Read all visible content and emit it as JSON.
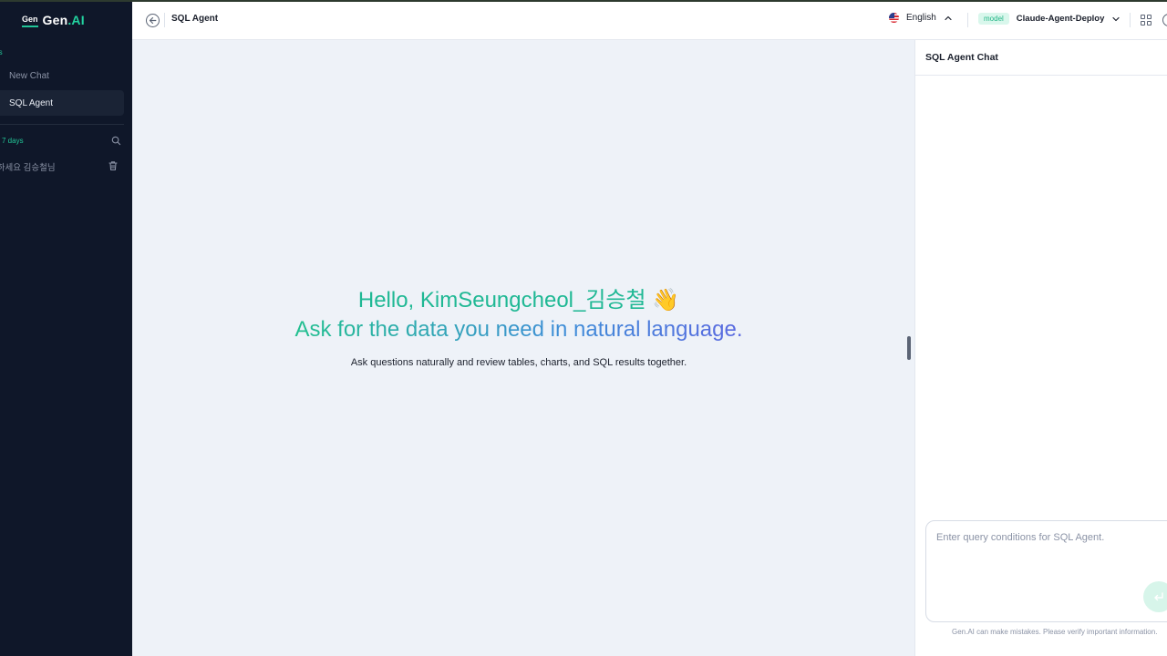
{
  "app": {
    "logo_badge": "Gen",
    "logo_name": "Gen",
    "logo_suffix": ".AI"
  },
  "sidebar": {
    "section_label": "ools",
    "items": [
      {
        "label": "New Chat"
      },
      {
        "label": "SQL Agent"
      }
    ],
    "history_header": "7 days",
    "history_items": [
      {
        "label": "녕하세요 김승철님"
      }
    ]
  },
  "topbar": {
    "title": "SQL Agent",
    "language": "English",
    "model_badge": "model",
    "model_name": "Claude-Agent-Deploy"
  },
  "main": {
    "greeting": "Hello, KimSeungcheol_김승철 👋",
    "headline": "Ask for the data you need in natural language.",
    "subtext": "Ask questions naturally and review tables, charts, and SQL results together."
  },
  "panel": {
    "title": "SQL Agent Chat",
    "input_placeholder": "Enter query conditions for SQL Agent.",
    "disclaimer": "Gen.AI can make mistakes. Please verify important information."
  },
  "colors": {
    "sidebar_bg": "#0f1729",
    "accent": "#22c597",
    "gradient_end": "#5a68e0",
    "main_bg": "#eef2f8"
  },
  "icons": [
    "back-arrow-icon",
    "search-icon",
    "trash-icon",
    "us-flag-icon",
    "chevron-up-icon",
    "chevron-down-icon",
    "grid-icon",
    "help-icon",
    "send-icon"
  ]
}
